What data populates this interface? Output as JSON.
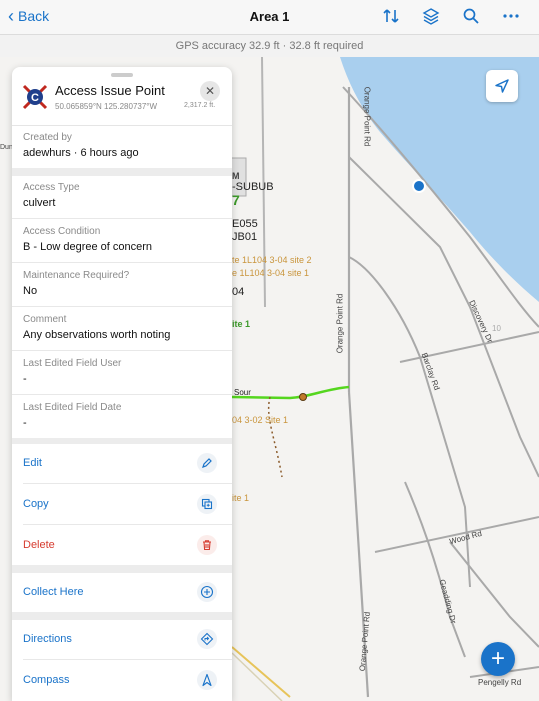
{
  "nav": {
    "back_label": "Back",
    "title": "Area 1"
  },
  "gps": {
    "text": "GPS accuracy 32.9 ft · 32.8 ft required"
  },
  "map": {
    "labels": {
      "m": "M",
      "subub": "-SUBUB",
      "seven": "7",
      "e055": "E055",
      "jb01": "JB01",
      "site2": "te 1L104 3-04 site 2",
      "site1": "e 1L104 3-04 site 1",
      "o4": "04",
      "site1g": "ite 1",
      "sour": "Sour",
      "site1b": "04 3-02 Site 1",
      "site1c": "ite 1",
      "dun": "Dun",
      "orange_point_rd_top": "Orange Point Rd",
      "orange_point_rd_mid": "Orange Point Rd",
      "orange_point_rd_bot": "Orange Point Rd",
      "discovery_dr": "Discovery Dr",
      "barclay_rd": "Barclay Rd",
      "wood_rd": "Wood Rd",
      "gooding_dr": "Geadding Dr",
      "pengelly_rd": "Pengelly Rd",
      "num_10": "10"
    },
    "colors": {
      "water": "#a9cfee",
      "road": "#a9a9a9",
      "highlight_road": "#55d61f"
    }
  },
  "panel": {
    "title": "Access Issue Point",
    "lat": "50.065859°N",
    "lon": "125.280737°W",
    "elevation": "2,317.2 ft.",
    "fields": [
      {
        "label": "Created by",
        "value": "adewhurs · 6 hours ago"
      },
      {
        "label": "Access Type",
        "value": "culvert"
      },
      {
        "label": "Access Condition",
        "value": "B - Low degree of concern"
      },
      {
        "label": "Maintenance Required?",
        "value": "No"
      },
      {
        "label": "Comment",
        "value": "Any observations worth noting"
      },
      {
        "label": "Last Edited Field User",
        "value": "-"
      },
      {
        "label": "Last Edited Field Date",
        "value": "-"
      }
    ],
    "actions": {
      "edit": "Edit",
      "copy": "Copy",
      "delete": "Delete",
      "collect": "Collect Here",
      "directions": "Directions",
      "compass": "Compass"
    }
  },
  "accent": "#1a73c9",
  "danger": "#d63b2f"
}
